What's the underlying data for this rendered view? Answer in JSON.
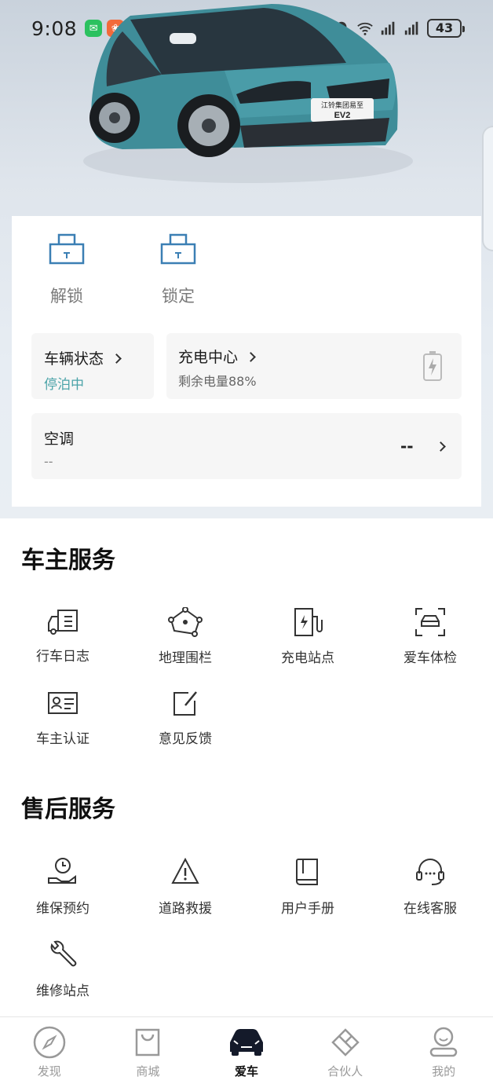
{
  "status_bar": {
    "time": "9:08",
    "battery": "43"
  },
  "vehicle_badge": {
    "line1": "江铃集团易至",
    "line2": "EV2"
  },
  "controls": {
    "unlock_label": "解锁",
    "lock_label": "锁定",
    "vehicle_status": {
      "title": "车辆状态",
      "value": "停泊中"
    },
    "charging_center": {
      "title": "充电中心",
      "subtitle": "剩余电量88%"
    },
    "air_conditioner": {
      "title": "空调",
      "subtitle": "--",
      "value": "--"
    }
  },
  "owner_services": {
    "title": "车主服务",
    "items": [
      {
        "label": "行车日志",
        "icon": "truck-log-icon"
      },
      {
        "label": "地理围栏",
        "icon": "geofence-icon"
      },
      {
        "label": "充电站点",
        "icon": "charging-station-icon"
      },
      {
        "label": "爱车体检",
        "icon": "car-scan-icon"
      },
      {
        "label": "车主认证",
        "icon": "id-card-icon"
      },
      {
        "label": "意见反馈",
        "icon": "feedback-icon"
      }
    ]
  },
  "after_sales": {
    "title": "售后服务",
    "items": [
      {
        "label": "维保预约",
        "icon": "maintenance-booking-icon"
      },
      {
        "label": "道路救援",
        "icon": "road-rescue-icon"
      },
      {
        "label": "用户手册",
        "icon": "manual-icon"
      },
      {
        "label": "在线客服",
        "icon": "headset-icon"
      },
      {
        "label": "维修站点",
        "icon": "wrench-icon"
      }
    ]
  },
  "bottom_nav": {
    "active": "爱车",
    "items": [
      {
        "label": "发现",
        "icon": "compass-icon"
      },
      {
        "label": "商城",
        "icon": "shopping-bag-icon"
      },
      {
        "label": "爱车",
        "icon": "car-icon"
      },
      {
        "label": "合伙人",
        "icon": "partner-icon"
      },
      {
        "label": "我的",
        "icon": "profile-icon"
      }
    ]
  },
  "colors": {
    "accent_teal": "#4aa3a8",
    "icon_blue": "#3b7fb4",
    "car_body": "#3f8d99",
    "text_primary": "#1b1b1b"
  }
}
